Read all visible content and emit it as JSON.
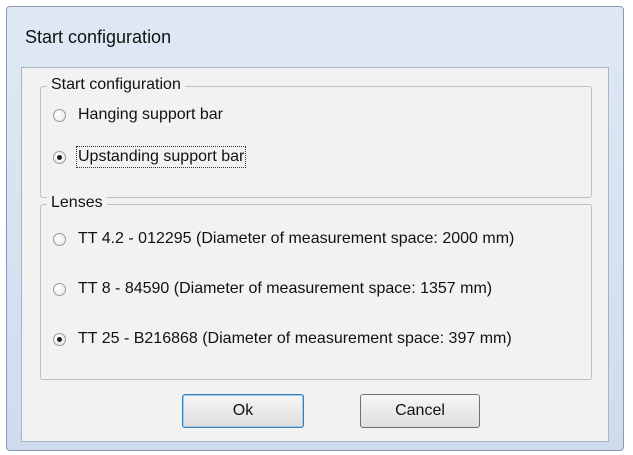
{
  "window": {
    "title": "Start configuration"
  },
  "start_group": {
    "legend": "Start configuration",
    "options": [
      {
        "label": "Hanging support bar",
        "checked": false
      },
      {
        "label": "Upstanding support bar",
        "checked": true
      }
    ]
  },
  "lenses_group": {
    "legend": "Lenses",
    "options": [
      {
        "label": "TT 4.2 - 012295  (Diameter of measurement space: 2000 mm)",
        "checked": false
      },
      {
        "label": "TT 8 - 84590  (Diameter of measurement space: 1357 mm)",
        "checked": false
      },
      {
        "label": "TT 25 - B216868  (Diameter of measurement space: 397 mm)",
        "checked": true
      }
    ]
  },
  "buttons": {
    "ok": "Ok",
    "cancel": "Cancel"
  }
}
